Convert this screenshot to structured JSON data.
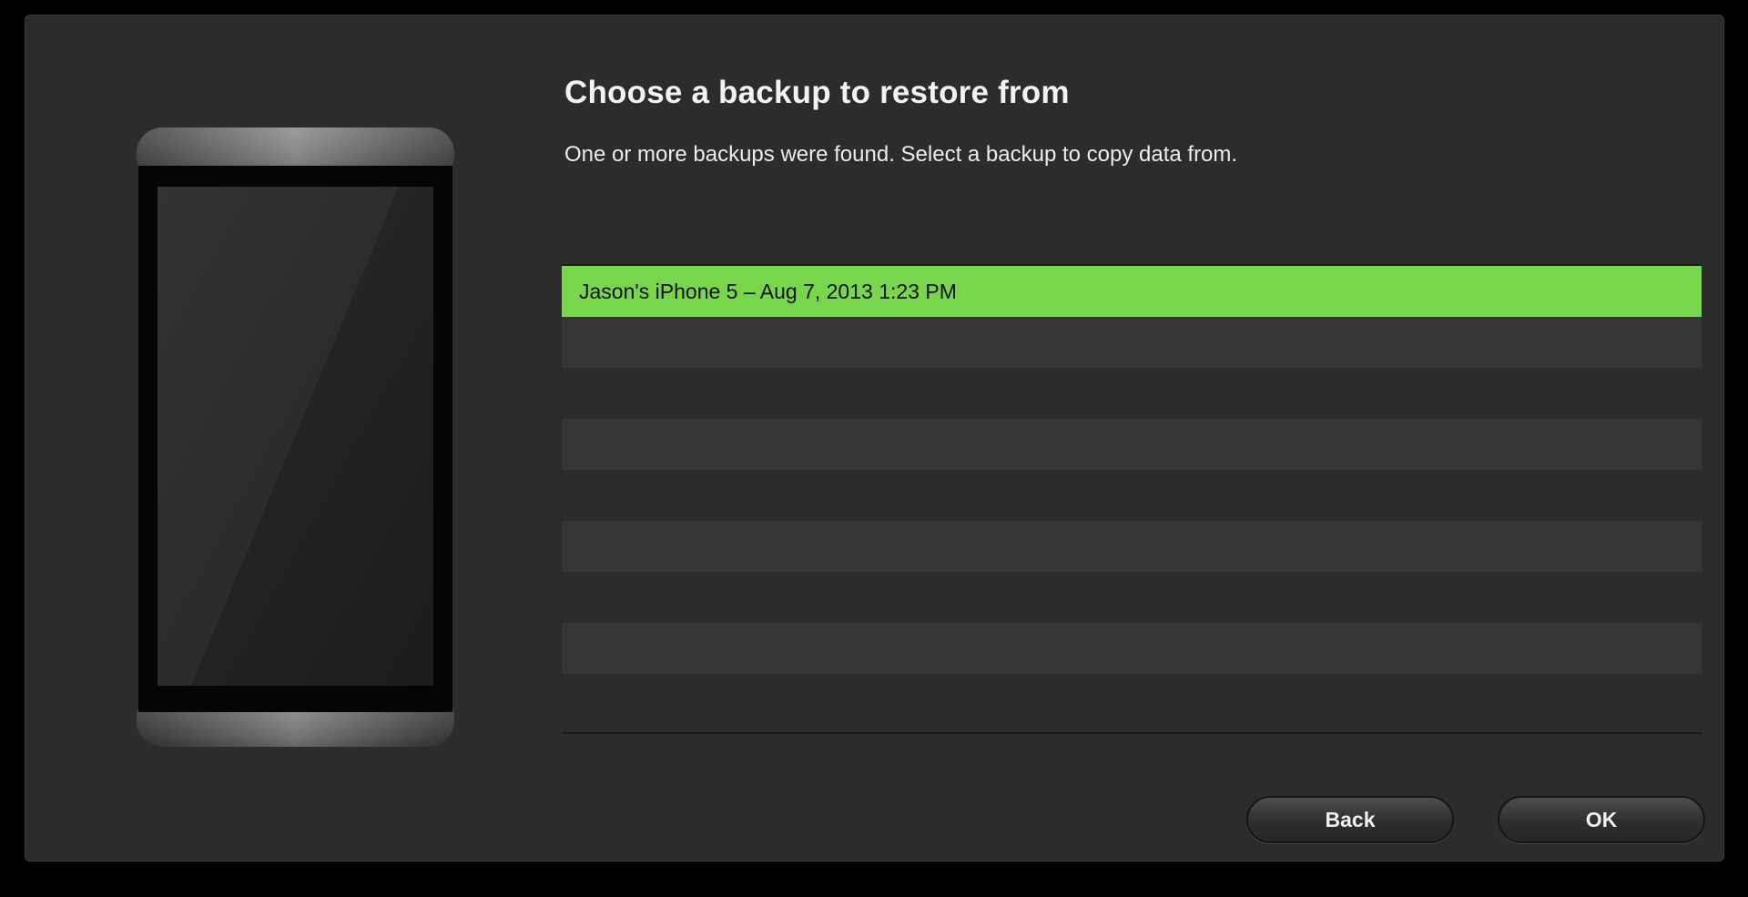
{
  "dialog": {
    "title": "Choose a backup to restore from",
    "subtitle": "One or more backups were found. Select a backup to copy data from."
  },
  "backups": {
    "items": [
      {
        "label": "Jason's iPhone 5 – Aug 7, 2013 1:23 PM",
        "selected": true
      }
    ],
    "empty_rows": 8
  },
  "buttons": {
    "back": "Back",
    "ok": "OK"
  },
  "colors": {
    "selection": "#78d64d",
    "background": "#2c2c2c"
  }
}
